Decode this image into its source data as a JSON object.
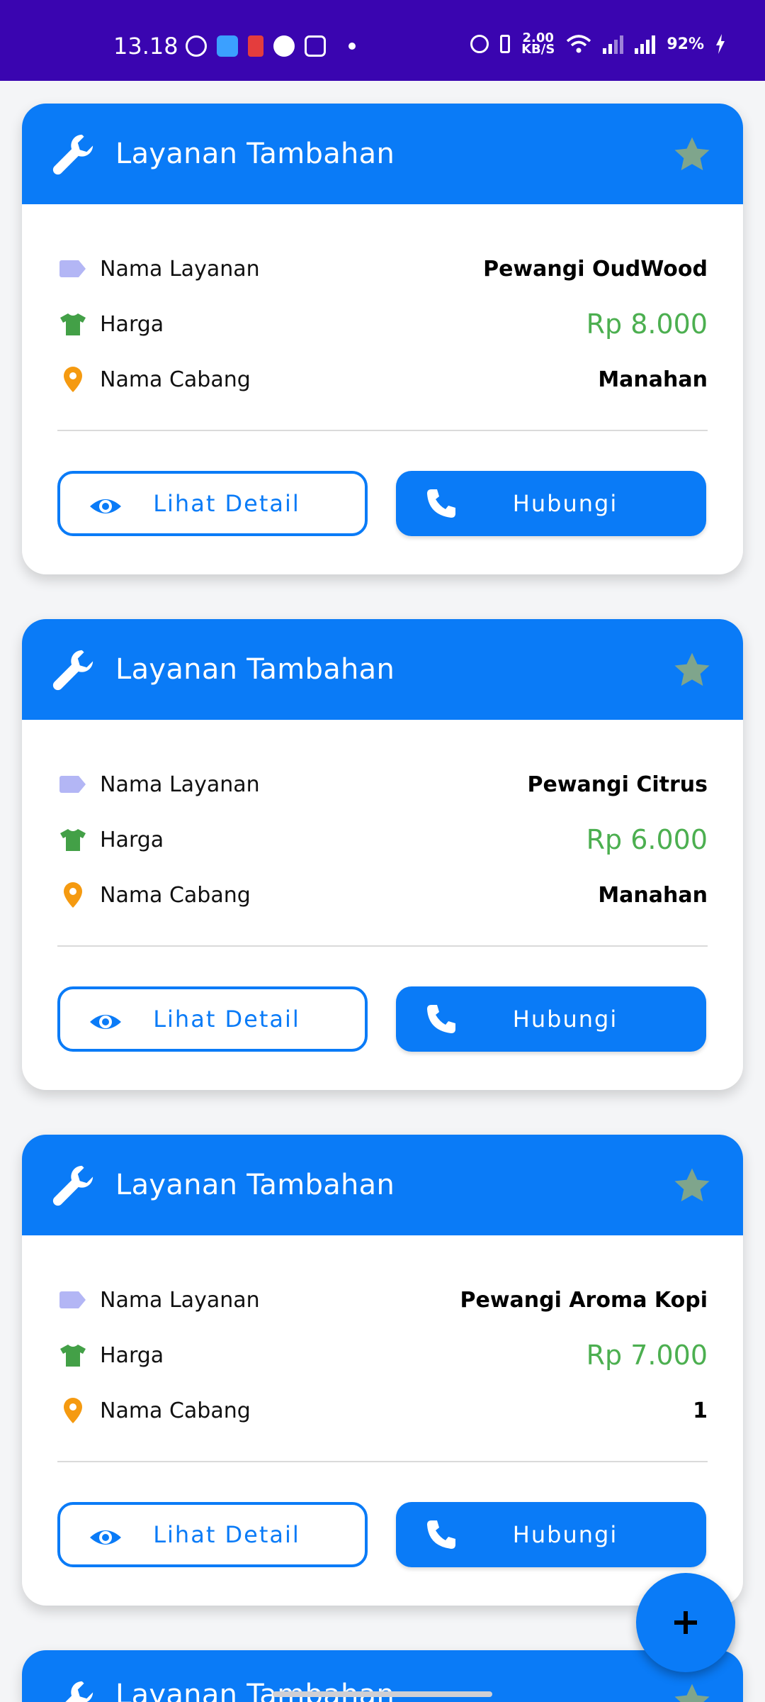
{
  "status_bar": {
    "time": "13.18",
    "net_speed_value": "2.00",
    "net_speed_unit": "KB/S",
    "battery": "92%"
  },
  "colors": {
    "header": "#0a7bf7",
    "price": "#4caf50",
    "status_bar": "#3a05b0",
    "star": "#7fa58c"
  },
  "labels": {
    "service_name": "Nama Layanan",
    "price": "Harga",
    "branch": "Nama Cabang"
  },
  "cards": [
    {
      "title": "Layanan Tambahan",
      "service_name": "Pewangi OudWood",
      "price": "Rp 8.000",
      "branch": "Manahan",
      "detail_button": "Lihat Detail",
      "contact_button": "Hubungi"
    },
    {
      "title": "Layanan Tambahan",
      "service_name": "Pewangi Citrus",
      "price": "Rp 6.000",
      "branch": "Manahan",
      "detail_button": "Lihat Detail",
      "contact_button": "Hubungi"
    },
    {
      "title": "Layanan Tambahan",
      "service_name": "Pewangi Aroma Kopi",
      "price": "Rp 7.000",
      "branch": "1",
      "detail_button": "Lihat Detail",
      "contact_button": "Hubungi"
    },
    {
      "title": "Layanan Tambahan"
    }
  ],
  "icons": {
    "header": "wrench-icon",
    "favorite": "star-icon",
    "service_name": "label-tag-icon",
    "price": "shirt-icon",
    "branch": "location-pin-icon",
    "detail": "eye-icon",
    "contact": "phone-icon",
    "fab": "plus-icon"
  }
}
